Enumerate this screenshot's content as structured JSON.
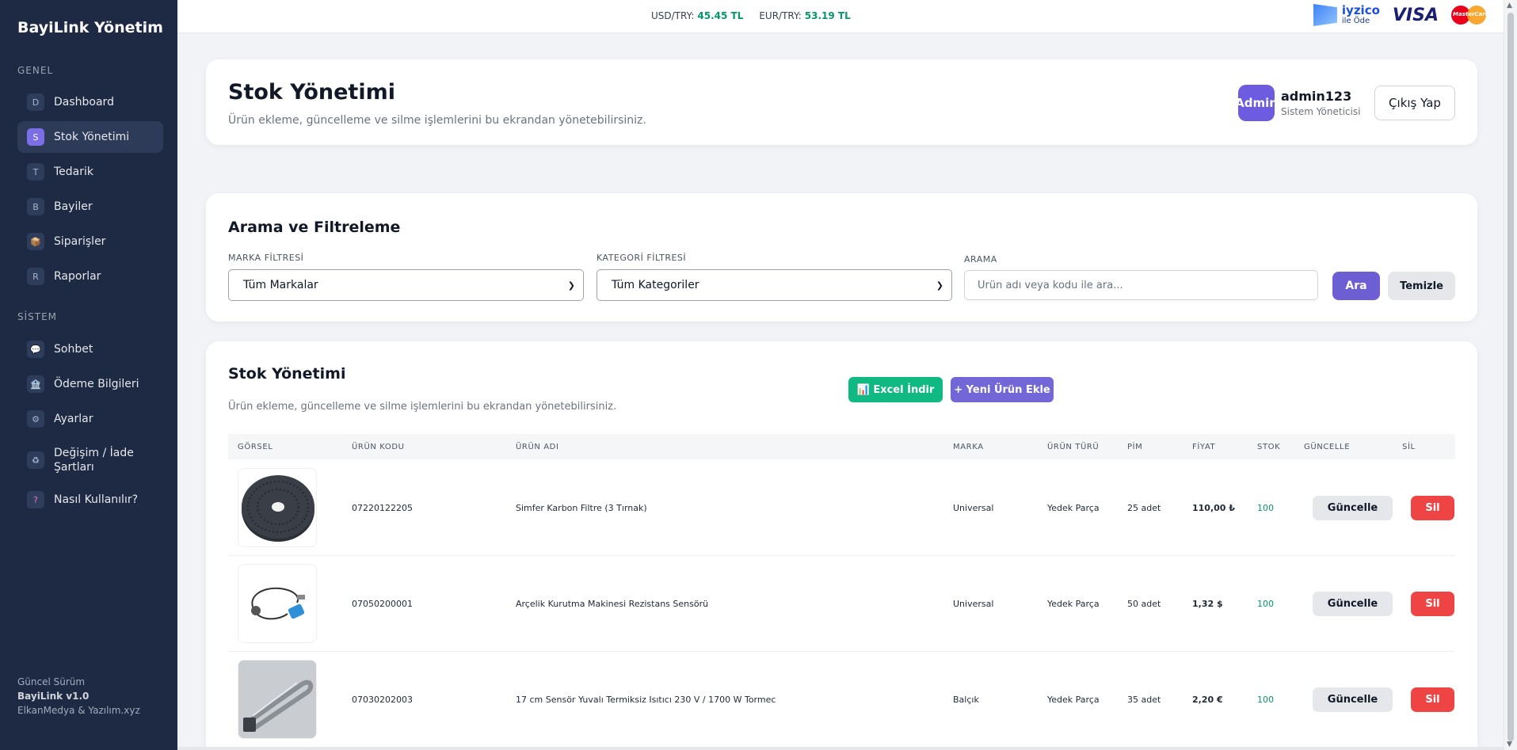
{
  "sidebar": {
    "brand": "BayiLink Yönetim",
    "section_general": "GENEL",
    "section_system": "SİSTEM",
    "items": [
      {
        "badge": "D",
        "label": "Dashboard"
      },
      {
        "badge": "S",
        "label": "Stok Yönetimi"
      },
      {
        "badge": "T",
        "label": "Tedarik"
      },
      {
        "badge": "B",
        "label": "Bayiler"
      },
      {
        "badge": "📦",
        "label": "Siparişler"
      },
      {
        "badge": "R",
        "label": "Raporlar"
      },
      {
        "badge": "💬",
        "label": "Sohbet"
      },
      {
        "badge": "🏦",
        "label": "Ödeme Bilgileri"
      },
      {
        "badge": "⚙",
        "label": "Ayarlar"
      },
      {
        "badge": "♻",
        "label": "Değişim / İade Şartları"
      },
      {
        "badge": "?",
        "label": "Nasıl Kullanılır?"
      }
    ],
    "version_label": "Güncel Sürüm",
    "version_name": "BayiLink v1.0",
    "credits": "ElkanMedya  &  Yazılım.xyz"
  },
  "topbar": {
    "usd_label": "USD/TRY:",
    "usd_value": "45.45 TL",
    "eur_label": "EUR/TRY:",
    "eur_value": "53.19 TL",
    "iyzico_name": "iyzico",
    "iyzico_sub": "ile Öde",
    "visa": "VISA",
    "mastercard": "MasterCard"
  },
  "header": {
    "title": "Stok Yönetimi",
    "subtitle": "Ürün ekleme, güncelleme ve silme işlemlerini bu ekrandan yönetebilirsiniz.",
    "avatar_text": "Admin",
    "user_name": "admin123",
    "user_role": "Sistem Yöneticisi",
    "logout_label": "Çıkış Yap"
  },
  "filters": {
    "title": "Arama ve Filtreleme",
    "brand_label": "MARKA FİLTRESİ",
    "brand_value": "Tüm Markalar",
    "category_label": "KATEGORİ FİLTRESİ",
    "category_value": "Tüm Kategoriler",
    "search_label": "ARAMA",
    "search_placeholder": "Ürün adı veya kodu ile ara...",
    "search_button": "Ara",
    "clear_button": "Temizle"
  },
  "table": {
    "title": "Stok Yönetimi",
    "subtitle": "Ürün ekleme, güncelleme ve silme işlemlerini bu ekrandan yönetebilirsiniz.",
    "excel_button": "📊 Excel İndir",
    "new_button": "+ Yeni Ürün Ekle",
    "columns": [
      "GÖRSEL",
      "ÜRÜN KODU",
      "ÜRÜN ADI",
      "MARKA",
      "ÜRÜN TÜRÜ",
      "PİM",
      "FİYAT",
      "STOK",
      "GÜNCELLE",
      "SİL"
    ],
    "update_label": "Güncelle",
    "delete_label": "Sil",
    "rows": [
      {
        "code": "07220122205",
        "name": "Simfer Karbon Filtre (3 Tırnak)",
        "brand": "Universal",
        "type": "Yedek Parça",
        "pin": "25 adet",
        "price": "110,00 ₺",
        "stock": "100",
        "image": "filter"
      },
      {
        "code": "07050200001",
        "name": "Arçelik Kurutma Makinesi Rezistans Sensörü",
        "brand": "Universal",
        "type": "Yedek Parça",
        "pin": "50 adet",
        "price": "1,32 $",
        "stock": "100",
        "image": "sensor"
      },
      {
        "code": "07030202003",
        "name": "17 cm Sensör Yuvalı Termiksiz Isıtıcı 230 V / 1700 W Tormec",
        "brand": "Balçık",
        "type": "Yedek Parça",
        "pin": "35 adet",
        "price": "2,20 €",
        "stock": "100",
        "image": "heater"
      }
    ]
  }
}
